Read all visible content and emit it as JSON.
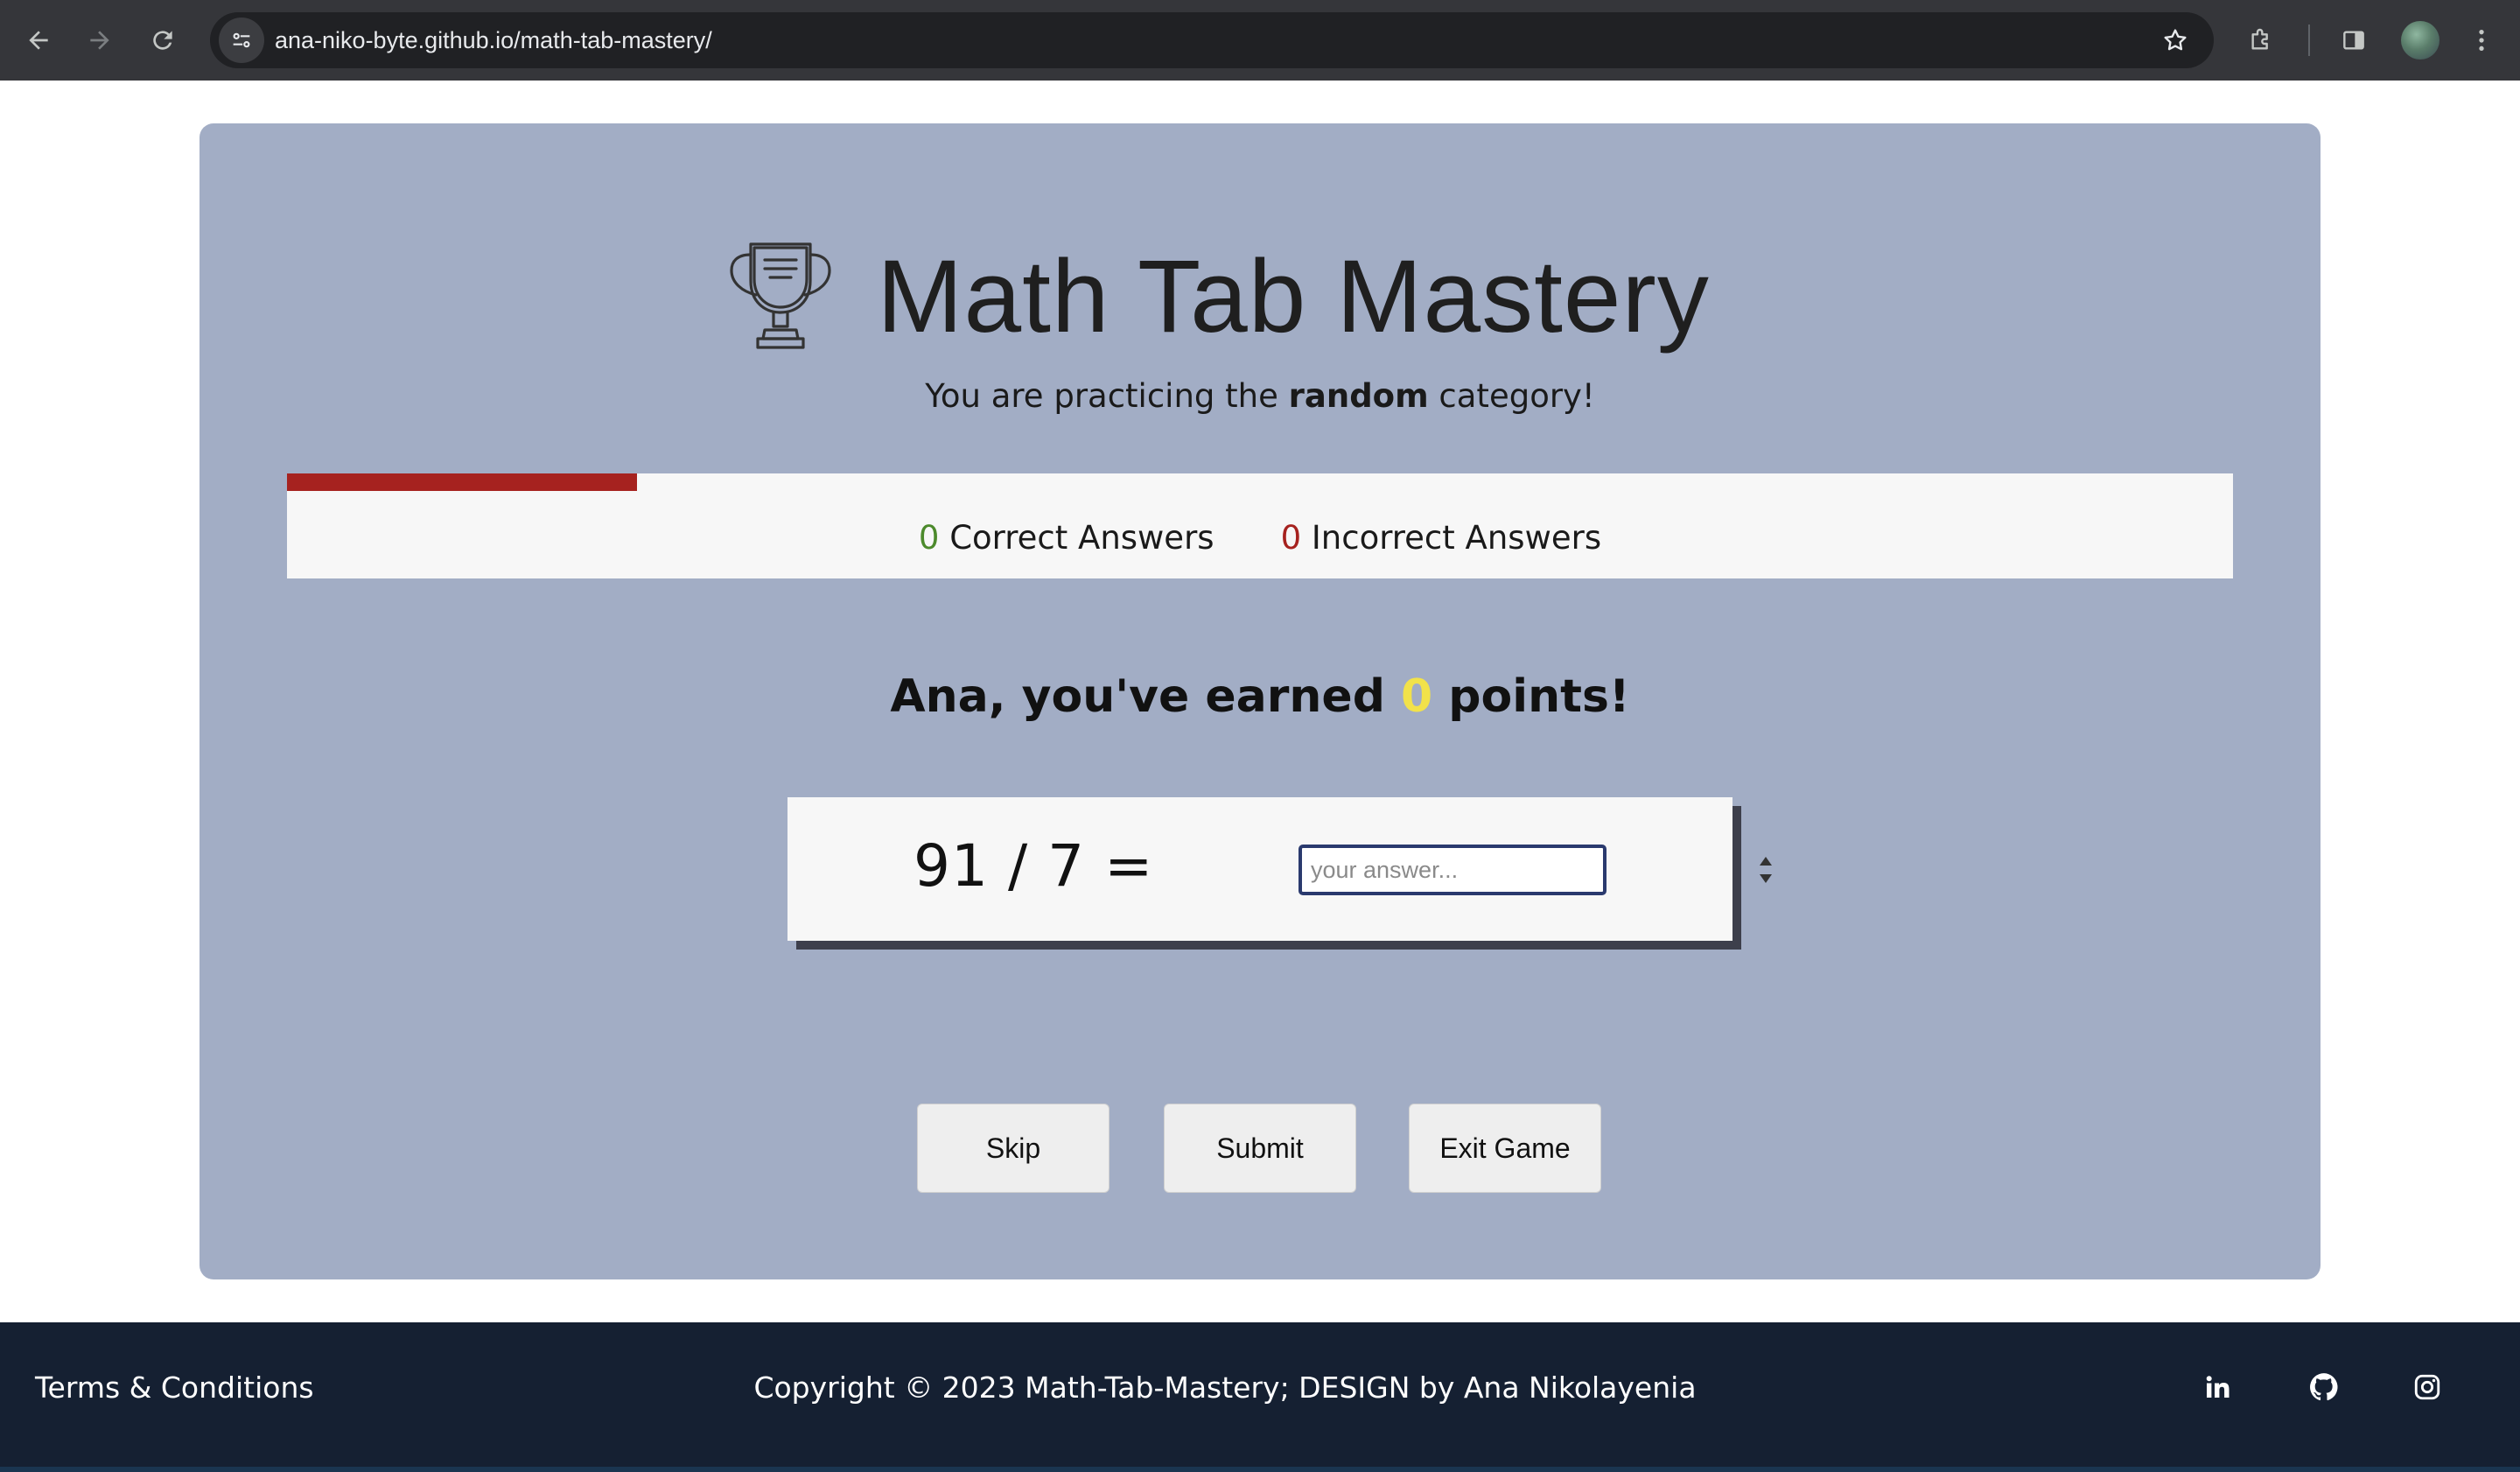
{
  "browser": {
    "url": "ana-niko-byte.github.io/math-tab-mastery/",
    "icons": [
      "back-arrow-icon",
      "forward-arrow-icon",
      "reload-icon",
      "site-info-icon",
      "bookmark-star-icon",
      "extensions-icon",
      "side-panel-icon",
      "profile-avatar",
      "more-menu-icon"
    ]
  },
  "header": {
    "title": "Math Tab Mastery",
    "subtitle_prefix": "You are practicing the ",
    "category": "random",
    "subtitle_suffix": " category!"
  },
  "progress": {
    "fraction": 0.18,
    "color": "#a6221f"
  },
  "score": {
    "correct_count": "0",
    "correct_label": " Correct Answers",
    "incorrect_count": "0",
    "incorrect_label": " Incorrect Answers"
  },
  "points": {
    "prefix": "Ana, you've earned ",
    "value": "0",
    "suffix": " points!"
  },
  "question": {
    "equation": "91 / 7 =",
    "answer_value": "",
    "answer_placeholder": "your answer..."
  },
  "buttons": {
    "skip": "Skip",
    "submit": "Submit",
    "exit": "Exit Game"
  },
  "footer": {
    "terms": "Terms & Conditions",
    "copyright": "Copyright © 2023 Math-Tab-Mastery; DESIGN by Ana Nikolayenia",
    "social_icons": [
      "linkedin-icon",
      "github-icon",
      "instagram-icon"
    ]
  },
  "colors": {
    "card_background": "#a2adc5",
    "correct": "#4c8a2c",
    "incorrect": "#a6221f",
    "points": "#f2e24a",
    "footer": "#152032"
  }
}
